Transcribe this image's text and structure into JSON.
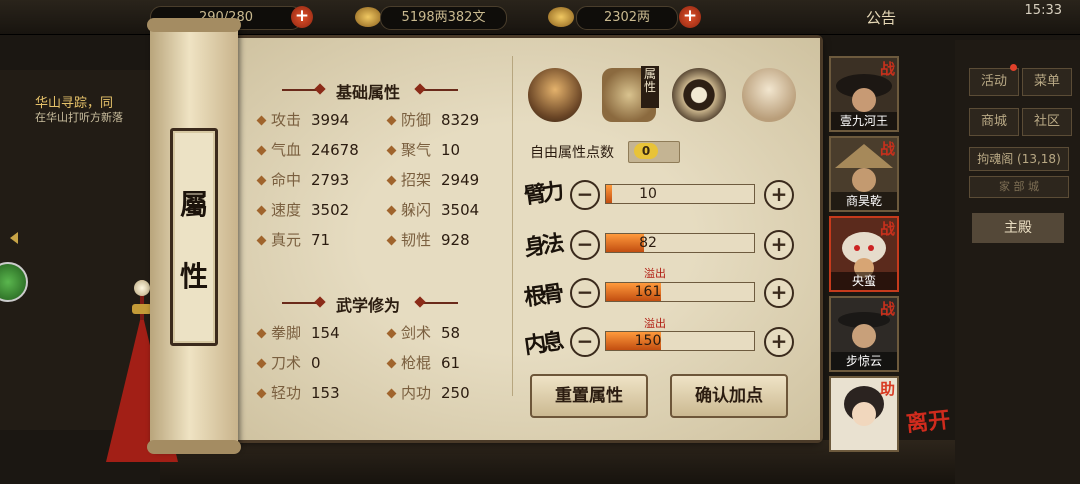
{
  "topbar": {
    "stamina": "290/280",
    "money": "5198两382文",
    "gold": "2302两",
    "notice": "公告",
    "time": "15:33"
  },
  "quest": {
    "title": "华山寻踪，同",
    "desc": "在华山打听方新落"
  },
  "sidebar_right": {
    "buttons": [
      "活动",
      "菜单",
      "商城",
      "社区"
    ],
    "location": "拘魂阁 (13,18)",
    "sub": "家  部  城",
    "main_hall": "主殿"
  },
  "scroll": {
    "plaque_top": "屬",
    "plaque_bottom": "性"
  },
  "basic": {
    "title": "基础属性",
    "stats": [
      {
        "label": "攻击",
        "value": "3994"
      },
      {
        "label": "防御",
        "value": "8329"
      },
      {
        "label": "气血",
        "value": "24678"
      },
      {
        "label": "聚气",
        "value": "10"
      },
      {
        "label": "命中",
        "value": "2793"
      },
      {
        "label": "招架",
        "value": "2949"
      },
      {
        "label": "速度",
        "value": "3502"
      },
      {
        "label": "躲闪",
        "value": "3504"
      },
      {
        "label": "真元",
        "value": "71"
      },
      {
        "label": "韧性",
        "value": "928"
      }
    ]
  },
  "martial": {
    "title": "武学修为",
    "stats": [
      {
        "label": "拳脚",
        "value": "154"
      },
      {
        "label": "剑术",
        "value": "58"
      },
      {
        "label": "刀术",
        "value": "0"
      },
      {
        "label": "枪棍",
        "value": "61"
      },
      {
        "label": "轻功",
        "value": "153"
      },
      {
        "label": "内功",
        "value": "250"
      }
    ]
  },
  "attr_tab_tag": "属性",
  "free_points": {
    "label": "自由属性点数",
    "value": "0"
  },
  "attributes": [
    {
      "name": "臂力",
      "value": "10",
      "fill": 0.04,
      "overflow": ""
    },
    {
      "name": "身法",
      "value": "82",
      "fill": 0.26,
      "overflow": ""
    },
    {
      "name": "根骨",
      "value": "161",
      "fill": 0.37,
      "overflow": "溢出"
    },
    {
      "name": "内息",
      "value": "150",
      "fill": 0.37,
      "overflow": "溢出"
    }
  ],
  "buttons": {
    "reset": "重置属性",
    "confirm": "确认加点"
  },
  "party": [
    {
      "name": "壹九河王",
      "tag": "战"
    },
    {
      "name": "商昊乾",
      "tag": "战"
    },
    {
      "name": "央蛮",
      "tag": "战"
    },
    {
      "name": "步惊云",
      "tag": "战"
    },
    {
      "name": "",
      "tag": "助"
    }
  ],
  "leave": "离开"
}
